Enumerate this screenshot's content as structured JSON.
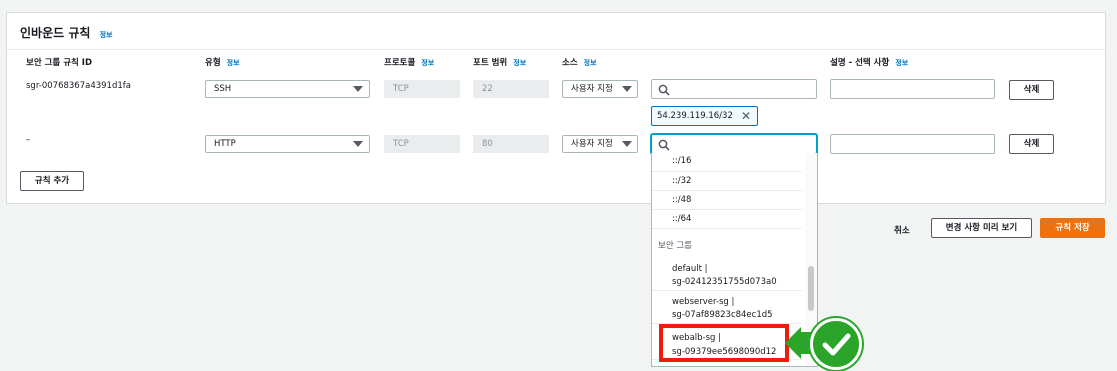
{
  "panel": {
    "title": "인바운드 규칙",
    "title_info": "정보"
  },
  "columns": {
    "sg_rule_id": "보안 그룹 규칙 ID",
    "type": "유형",
    "type_info": "정보",
    "protocol": "프로토콜",
    "protocol_info": "정보",
    "port_range": "포트 범위",
    "port_range_info": "정보",
    "source": "소스",
    "source_info": "정보",
    "description": "설명 - 선택 사항",
    "description_info": "정보"
  },
  "rows": [
    {
      "rule_id": "sgr-00768367a4391d1fa",
      "type": "SSH",
      "protocol": "TCP",
      "port": "22",
      "source_type": "사용자 지정",
      "source_search": "",
      "token": "54.239.119.16/32",
      "description": "",
      "delete_label": "삭제"
    },
    {
      "rule_id": "–",
      "type": "HTTP",
      "protocol": "TCP",
      "port": "80",
      "source_type": "사용자 지정",
      "source_search": "",
      "description": "",
      "delete_label": "삭제"
    }
  ],
  "add_rule_label": "규칙 추가",
  "dropdown": {
    "cidr_options": [
      "::/16",
      "::/32",
      "::/48",
      "::/64"
    ],
    "group_label": "보안 그룹",
    "sg_options": [
      {
        "line1": "default |",
        "line2": "sg-02412351755d073a0"
      },
      {
        "line1": "webserver-sg |",
        "line2": "sg-07af89823c84ec1d5"
      },
      {
        "line1": "webalb-sg |",
        "line2": "sg-09379ee5698090d12"
      }
    ]
  },
  "footer": {
    "cancel": "취소",
    "preview": "변경 사항 미리 보기",
    "save": "규칙 저장"
  },
  "colors": {
    "accent": "#0073bb",
    "primary": "#ec7211",
    "highlight": "#f01b0c",
    "check": "#2aa52a"
  }
}
